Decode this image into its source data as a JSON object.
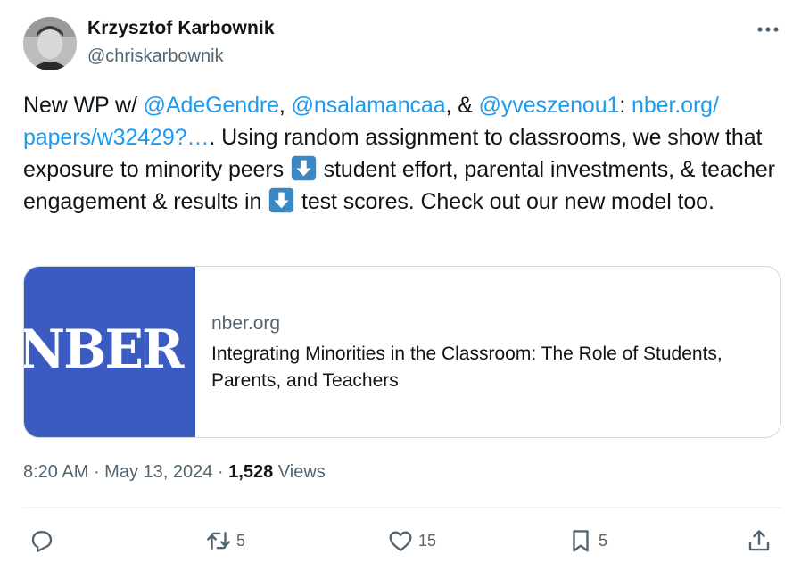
{
  "author": {
    "name": "Krzysztof Karbownik",
    "handle": "@chriskarbownik"
  },
  "tweet": {
    "t1": "New WP w/ ",
    "mention1": "@AdeGendre",
    "t2": ", ",
    "mention2": "@nsalamancaa",
    "t3": ", & ",
    "mention3": "@yveszenou1",
    "t4": ": ",
    "link_part1": "nber.org/",
    "link_part2": "papers/w32429?…",
    "t5": ". Using random assignment to classrooms, we show that exposure to minority peers ",
    "t6": " student effort, parental investments, & teacher engagement & results in ",
    "t7": " test scores. Check out our new model too."
  },
  "card": {
    "image_text": "NBER",
    "domain": "nber.org",
    "title": "Integrating Minorities in the Classroom: The Role of Students, Parents, and Teachers"
  },
  "meta": {
    "time": "8:20 AM",
    "sep1": " · ",
    "date": "May 13, 2024",
    "sep2": " · ",
    "views_count": "1,528",
    "views_label": " Views"
  },
  "actions": {
    "retweets": "5",
    "likes": "15",
    "bookmarks": "5"
  },
  "colors": {
    "link": "#1d9bf0",
    "muted": "#536471",
    "text": "#0f1419",
    "emoji_blue": "#3b88c3",
    "card_image_bg": "#3b5bc0"
  },
  "icons": [
    "more-icon",
    "arrow-down-emoji",
    "reply-icon",
    "retweet-icon",
    "like-icon",
    "bookmark-icon",
    "share-icon"
  ]
}
